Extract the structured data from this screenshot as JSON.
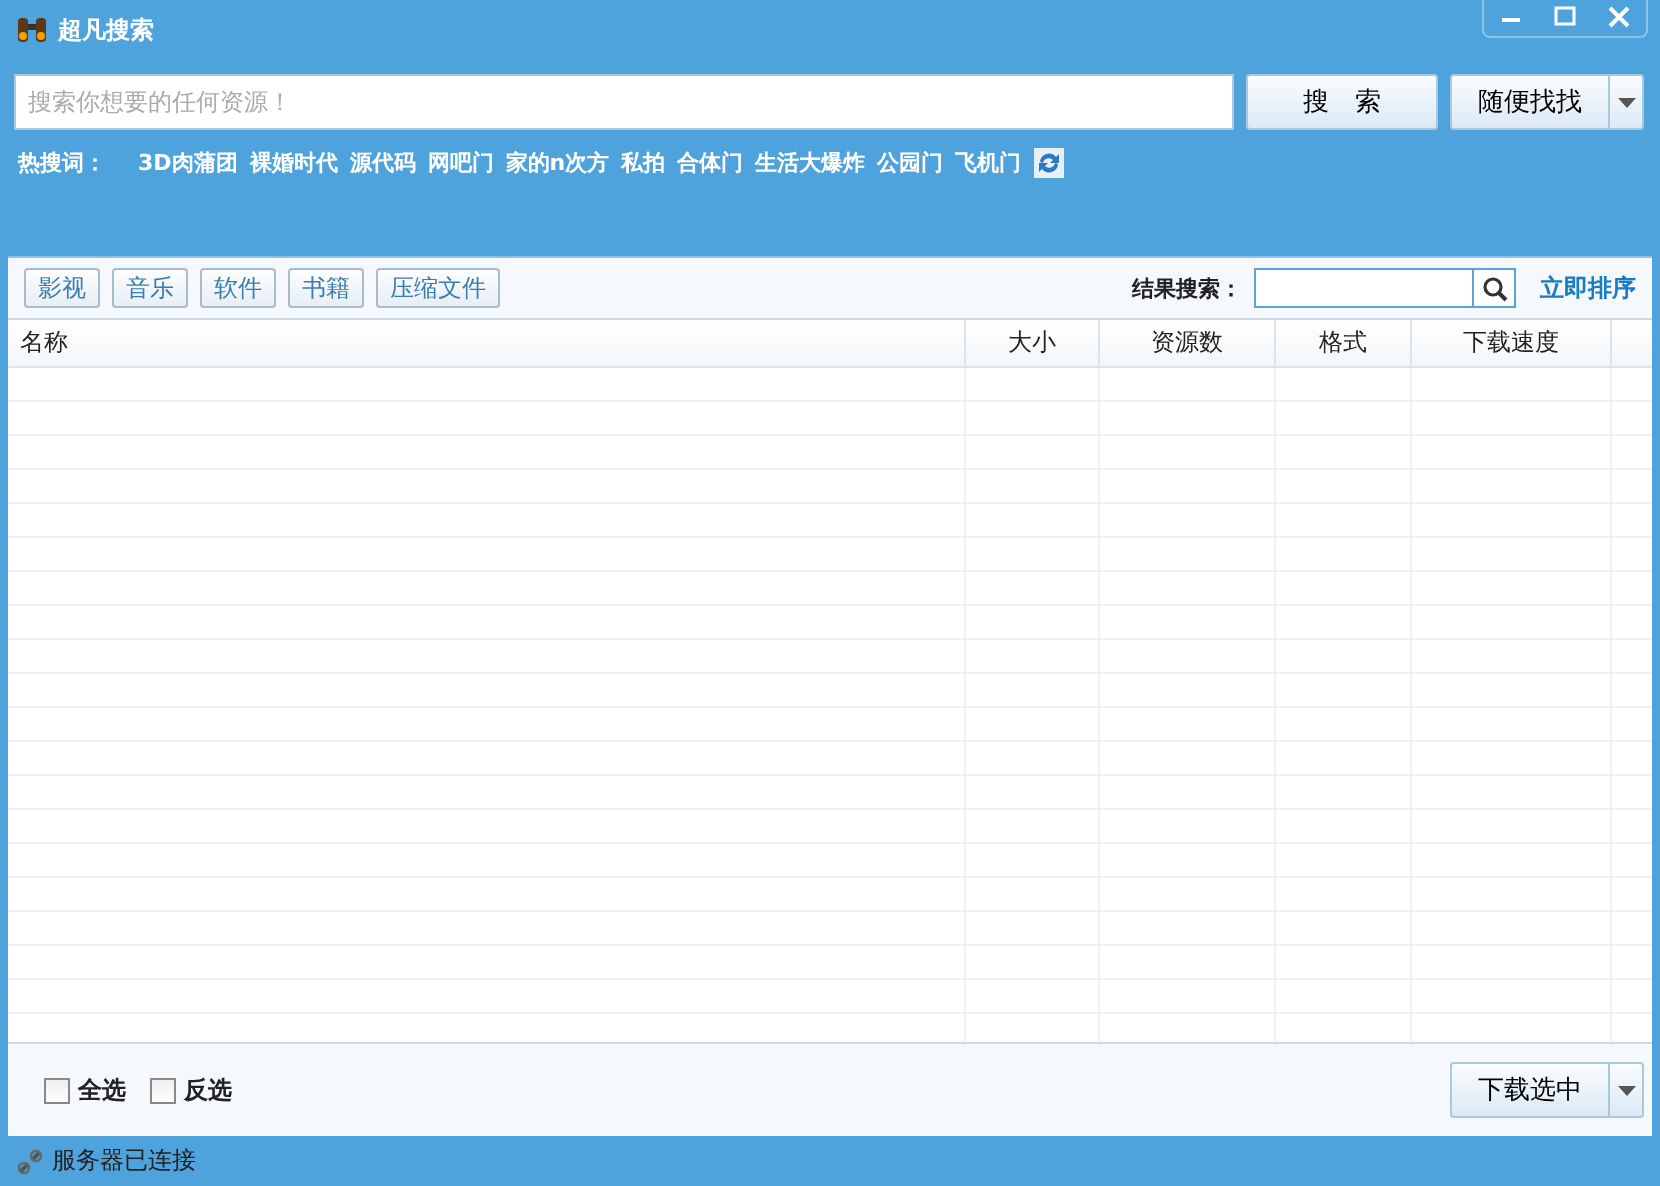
{
  "window": {
    "title": "超凡搜索"
  },
  "search": {
    "placeholder": "搜索你想要的任何资源！",
    "button": "搜　索",
    "random_button": "随便找找"
  },
  "hot_words": {
    "label": "热搜词：",
    "items": [
      "3D肉蒲团",
      "裸婚时代",
      "源代码",
      "网吧门",
      "家的n次方",
      "私拍",
      "合体门",
      "生活大爆炸",
      "公园门",
      "飞机门"
    ]
  },
  "categories": [
    "影视",
    "音乐",
    "软件",
    "书籍",
    "压缩文件"
  ],
  "result_search": {
    "label": "结果搜索：",
    "sort_link": "立即排序"
  },
  "table": {
    "columns": [
      "名称",
      "大小",
      "资源数",
      "格式",
      "下载速度"
    ]
  },
  "footer": {
    "checkboxes": [
      {
        "label": "全选",
        "checked": false
      },
      {
        "label": "反选",
        "checked": false
      }
    ],
    "download_button": "下载选中"
  },
  "status_bar": {
    "text": "服务器已连接"
  }
}
